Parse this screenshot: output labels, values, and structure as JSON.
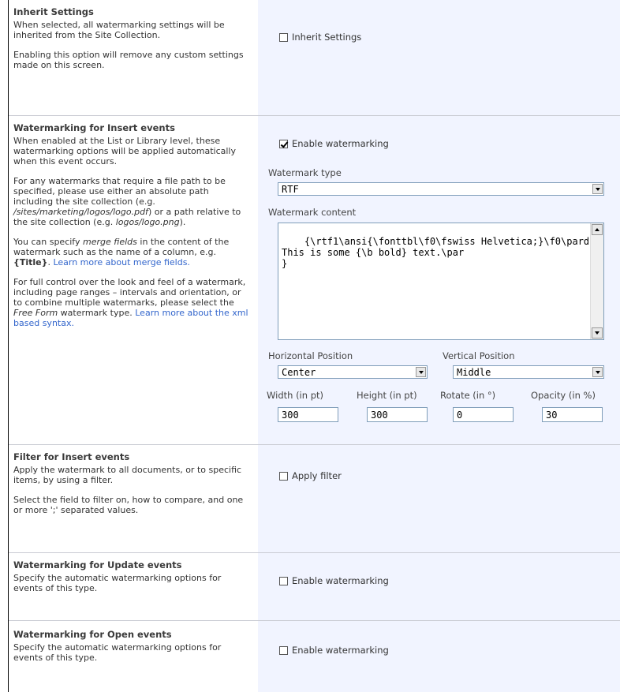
{
  "inherit": {
    "title": "Inherit Settings",
    "desc1": "When selected, all watermarking settings will be inherited from the Site Collection.",
    "desc2": "Enabling this option will remove any custom settings made on this screen.",
    "checkbox_label": "Inherit Settings",
    "checked": false
  },
  "insert": {
    "title": "Watermarking for Insert events",
    "desc1": "When enabled at the List or Library level, these watermarking options will be applied automatically when this event occurs.",
    "desc2a": "For any watermarks that require a file path to be specified, please use either an absolute path including the site collection (e.g. ",
    "desc2_path1": "/sites/marketing/logos/logo.pdf",
    "desc2b": ") or a path relative to the site collection (e.g. ",
    "desc2_path2": "logos/logo.png",
    "desc2c": ").",
    "desc3a": "You can specify ",
    "desc3_em": "merge fields",
    "desc3b": " in the content of the watermark such as the name of a column, e.g. ",
    "desc3_field": "{Title}",
    "desc3c": ". ",
    "desc3_link": "Learn more about merge fields.",
    "desc4a": "For full control over the look and feel of a watermark, including page ranges – intervals and orientation, or to combine multiple watermarks, please select the ",
    "desc4_em": "Free Form",
    "desc4b": " watermark type. ",
    "desc4_link": "Learn more about the xml based syntax.",
    "checkbox_label": "Enable watermarking",
    "checked": true,
    "type_label": "Watermark type",
    "type_value": "RTF",
    "content_label": "Watermark content",
    "content_value": "{\\rtf1\\ansi{\\fonttbl\\f0\\fswiss Helvetica;}\\f0\\pard\nThis is some {\\b bold} text.\\par\n}",
    "hpos_label": "Horizontal Position",
    "hpos_value": "Center",
    "vpos_label": "Vertical Position",
    "vpos_value": "Middle",
    "width_label": "Width (in pt)",
    "width_value": "300",
    "height_label": "Height (in pt)",
    "height_value": "300",
    "rotate_label": "Rotate (in °)",
    "rotate_value": "0",
    "opacity_label": "Opacity (in %)",
    "opacity_value": "30"
  },
  "filter": {
    "title": "Filter for Insert events",
    "desc1": "Apply the watermark to all documents, or to specific items, by using a filter.",
    "desc2": "Select the field to filter on, how to compare, and one or more ';' separated values.",
    "checkbox_label": "Apply filter",
    "checked": false
  },
  "update": {
    "title": "Watermarking for Update events",
    "desc1": "Specify the automatic watermarking options for events of this type.",
    "checkbox_label": "Enable watermarking",
    "checked": false
  },
  "open": {
    "title": "Watermarking for Open events",
    "desc1": "Specify the automatic watermarking options for events of this type.",
    "checkbox_label": "Enable watermarking",
    "checked": false
  },
  "colors": {
    "right_pane_bg": "#f1f4ff",
    "link": "#3366cc",
    "separator": "#c9cbd3"
  }
}
